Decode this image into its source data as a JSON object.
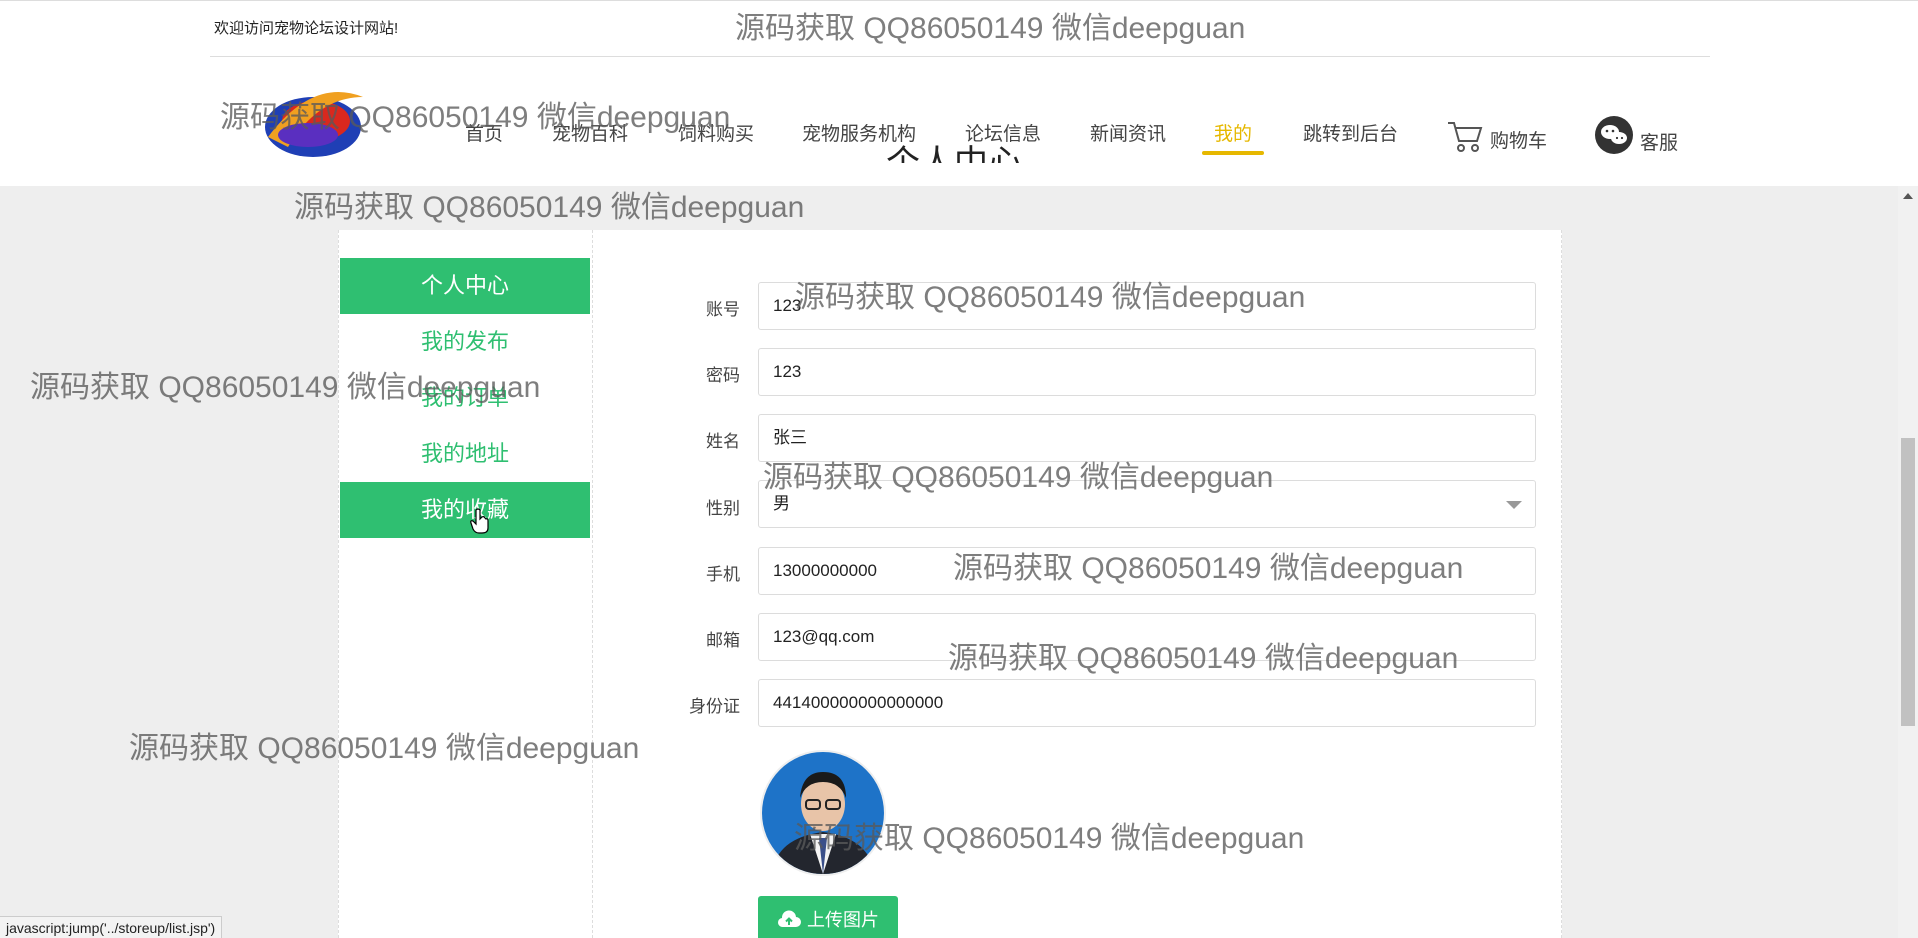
{
  "header": {
    "welcome": "欢迎访问宠物论坛设计网站!",
    "nav": [
      {
        "label": "首页"
      },
      {
        "label": "宠物百科"
      },
      {
        "label": "饲料购买"
      },
      {
        "label": "宠物服务机构"
      },
      {
        "label": "论坛信息"
      },
      {
        "label": "新闻资讯"
      },
      {
        "label": "我的",
        "active": true
      },
      {
        "label": "跳转到后台"
      }
    ],
    "cart_label": "购物车",
    "service_label": "客服",
    "accent_color": "#e6b800"
  },
  "page_title": "个人中心",
  "sidebar": {
    "items": [
      {
        "label": "个人中心",
        "filled": true
      },
      {
        "label": "我的发布"
      },
      {
        "label": "我的订单"
      },
      {
        "label": "我的地址"
      },
      {
        "label": "我的收藏",
        "filled": true
      }
    ],
    "color": "#2fbf71"
  },
  "form": {
    "account": {
      "label": "账号",
      "value": "123"
    },
    "password": {
      "label": "密码",
      "value": "123"
    },
    "name": {
      "label": "姓名",
      "value": "张三"
    },
    "gender": {
      "label": "性别",
      "value": "男"
    },
    "phone": {
      "label": "手机",
      "value": "13000000000"
    },
    "email": {
      "label": "邮箱",
      "value": "123@qq.com"
    },
    "id_card": {
      "label": "身份证",
      "value": "441400000000000000"
    }
  },
  "upload_label": "上传图片",
  "status_url": "javascript:jump('../storeup/list.jsp')",
  "watermark": "源码获取 QQ86050149 微信deepguan"
}
